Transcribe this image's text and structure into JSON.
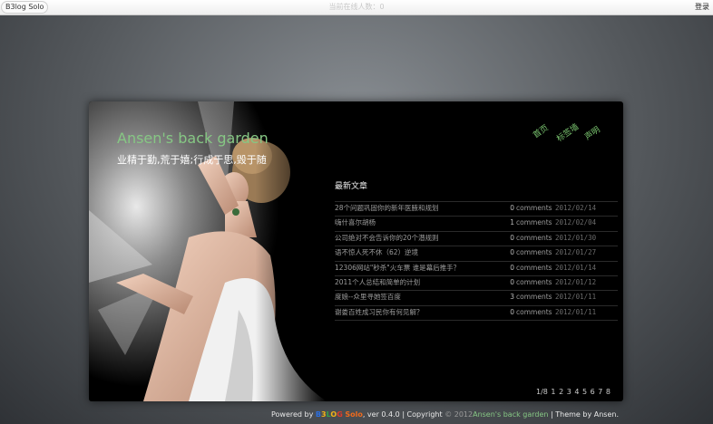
{
  "topbar": {
    "brand": "B3log Solo",
    "online": "当前在线人数：0",
    "login": "登录"
  },
  "site": {
    "title": "Ansen's back garden",
    "subtitle": "业精于勤,荒于嬉;行成于思,毁于随"
  },
  "nav": {
    "items": [
      {
        "label": "首页"
      },
      {
        "label": "标签墙"
      },
      {
        "label": "声明"
      }
    ]
  },
  "recent": {
    "heading": "最新文章",
    "comments_label": "comments",
    "articles": [
      {
        "title": "28个问题巩固你的新年医腋和规划",
        "count": "0",
        "date": "2012/02/14"
      },
      {
        "title": "嗨什喜尔胡杨",
        "count": "1",
        "date": "2012/02/04"
      },
      {
        "title": "公司绝对不会告诉你的20个潜规则",
        "count": "0",
        "date": "2012/01/30"
      },
      {
        "title": "语不惊人死不休（62）逆境",
        "count": "0",
        "date": "2012/01/27"
      },
      {
        "title": "12306网站\"秒杀\"火车票 谁是幕后推手？",
        "count": "0",
        "date": "2012/01/14"
      },
      {
        "title": "2011个人总结和简单的计划",
        "count": "0",
        "date": "2012/01/12"
      },
      {
        "title": "度娘--众里寻她签百度",
        "count": "3",
        "date": "2012/01/11"
      },
      {
        "title": "谢娄百姓成习民你有何见解？",
        "count": "0",
        "date": "2012/01/11"
      }
    ]
  },
  "pager": {
    "current": "1/8",
    "pages": [
      "1",
      "2",
      "3",
      "4",
      "5",
      "6",
      "7",
      "8"
    ]
  },
  "footer": {
    "powered_by": "Powered by",
    "logo_b": "B",
    "logo_3": "3",
    "logo_l": "L",
    "logo_o": "O",
    "logo_g": "G",
    "logo_solo": "Solo",
    "version": ", ver 0.4.0",
    "copyright": "| Copyright",
    "year": "© 2012",
    "site_link": "Ansen's back garden",
    "theme": "| Theme by Ansen."
  },
  "colors": {
    "accent_green": "#86c784",
    "panel_bg": "#000000"
  }
}
